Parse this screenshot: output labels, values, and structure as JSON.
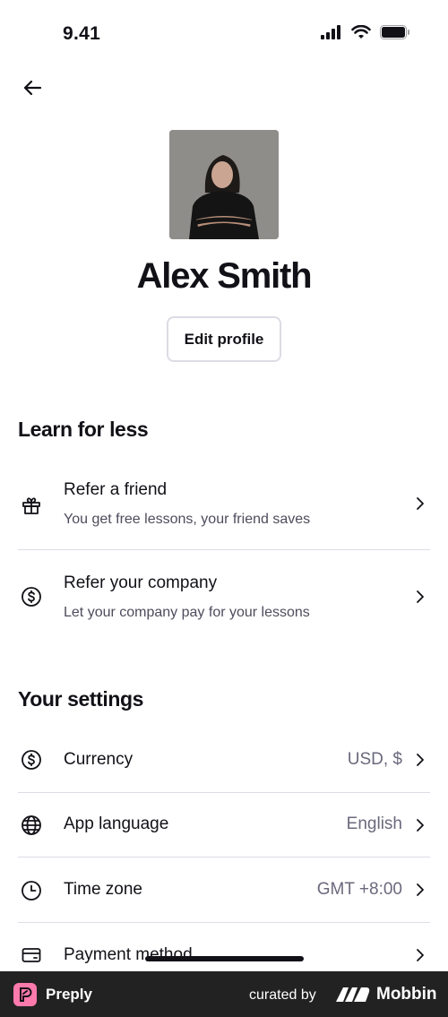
{
  "status_bar": {
    "time": "9.41"
  },
  "profile": {
    "name": "Alex Smith",
    "edit_label": "Edit profile"
  },
  "learn_section": {
    "title": "Learn for less",
    "items": [
      {
        "icon": "gift-icon",
        "title": "Refer a friend",
        "subtitle": "You get free lessons, your friend saves"
      },
      {
        "icon": "dollar-circle-icon",
        "title": "Refer your company",
        "subtitle": "Let your company pay for your lessons"
      }
    ]
  },
  "settings_section": {
    "title": "Your settings",
    "items": [
      {
        "icon": "dollar-circle-icon",
        "label": "Currency",
        "value": "USD, $"
      },
      {
        "icon": "globe-icon",
        "label": "App language",
        "value": "English"
      },
      {
        "icon": "clock-icon",
        "label": "Time zone",
        "value": "GMT +8:00"
      },
      {
        "icon": "credit-card-icon",
        "label": "Payment method",
        "value": ""
      }
    ]
  },
  "footer": {
    "app_name": "Preply",
    "curated_by": "curated by",
    "brand": "Mobbin"
  },
  "colors": {
    "text": "#121117",
    "subtext": "#4d4c5c",
    "divider": "#dcdce5",
    "footer_bg": "#222222",
    "brand_pink": "#ff7aac"
  }
}
